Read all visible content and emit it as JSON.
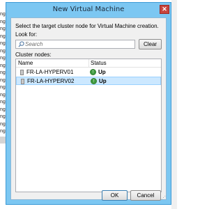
{
  "background": {
    "left_fragments": [
      "ng",
      "ng",
      "ng",
      "ng",
      "ng",
      "ng",
      "ng",
      "ng",
      "ng",
      "ng",
      "ng",
      "ng",
      "ng",
      "ng",
      "ng",
      "ng",
      "ng",
      "ng"
    ]
  },
  "dialog": {
    "title": "New Virtual Machine",
    "close_glyph": "✕",
    "instruction": "Select the target cluster node for Virtual Machine creation.",
    "look_for_label": "Look for:",
    "search_placeholder": "Search",
    "clear_label": "Clear",
    "cluster_nodes_label": "Cluster nodes:",
    "columns": {
      "name": "Name",
      "status": "Status"
    },
    "nodes": [
      {
        "name": "FR-LA-HYPERV01",
        "status": "Up",
        "selected": false
      },
      {
        "name": "FR-LA-HYPERV02",
        "status": "Up",
        "selected": true
      }
    ],
    "ok_label": "OK",
    "cancel_label": "Cancel",
    "status_icon": "up-arrow-icon"
  },
  "colors": {
    "title_bar": "#7cc7f2",
    "close_button": "#c7453d",
    "selection": "#cce8ff",
    "status_up": "#3f9b3f"
  }
}
